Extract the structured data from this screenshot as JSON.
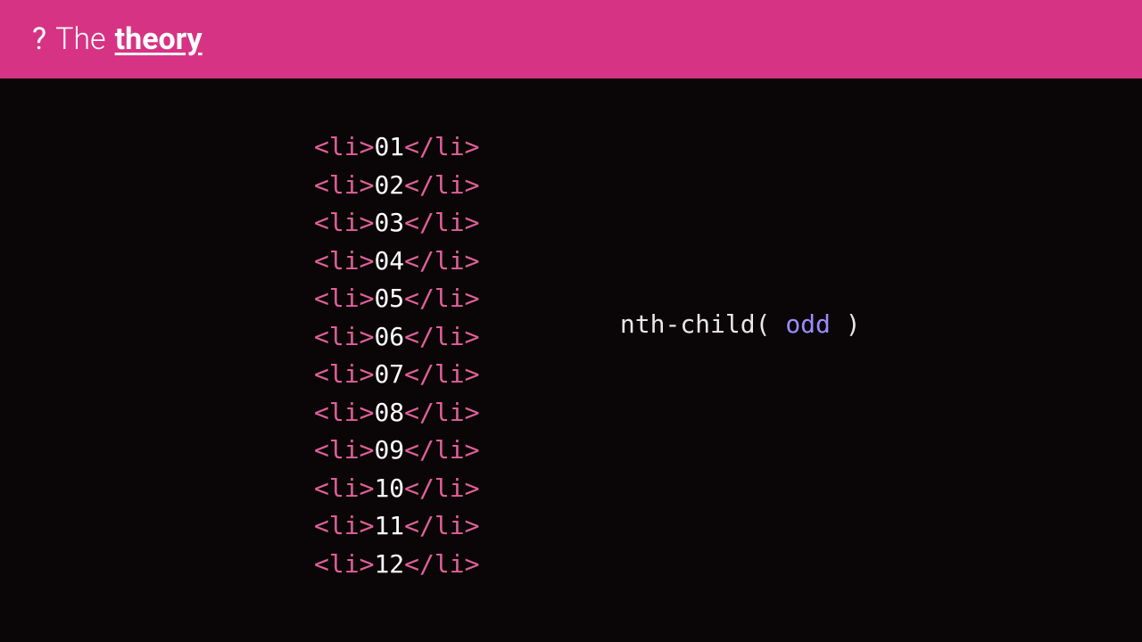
{
  "header": {
    "prefix": "?",
    "word1": "The",
    "word2": "theory"
  },
  "list": {
    "open_tag": "<li>",
    "close_tag": "</li>",
    "items": [
      "01",
      "02",
      "03",
      "04",
      "05",
      "06",
      "07",
      "08",
      "09",
      "10",
      "11",
      "12"
    ]
  },
  "selector": {
    "prefix": "nth-child( ",
    "keyword": "odd",
    "suffix": " )"
  }
}
